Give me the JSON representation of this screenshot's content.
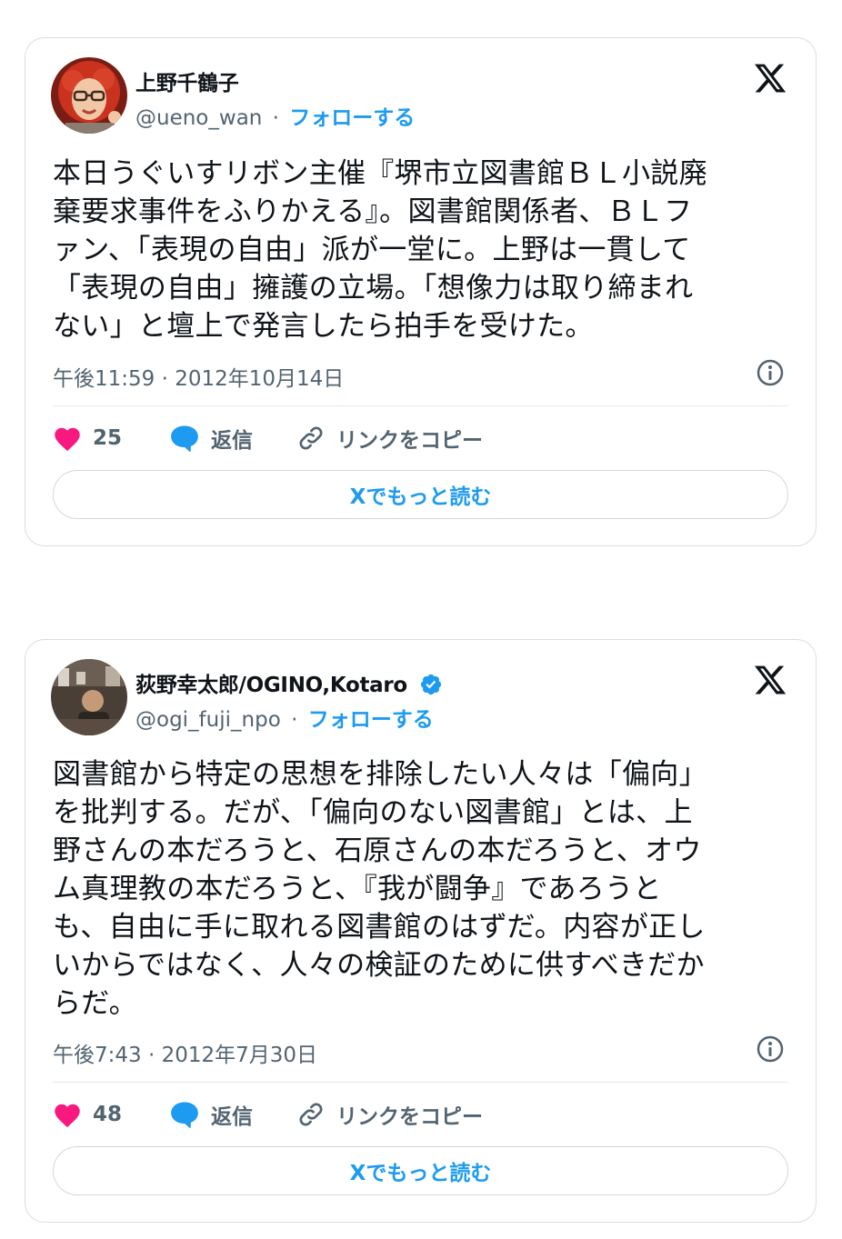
{
  "tweets": [
    {
      "author_name": "上野千鶴子",
      "handle": "@ueno_wan",
      "separator": "·",
      "follow_label": "フォローする",
      "verified": false,
      "body": "本日うぐいすリボン主催『堺市立図書館ＢＬ小説廃\n棄要求事件をふりかえる』。図書館関係者、ＢＬフ\nァン、「表現の自由」派が一堂に。上野は一貫して\n「表現の自由」擁護の立場。「想像力は取り締まれ\nない」と壇上で発言したら拍手を受けた。",
      "timestamp": "午後11:59 · 2012年10月14日",
      "likes": "25",
      "reply_label": "返信",
      "copy_link_label": "リンクをコピー",
      "read_more_label": "Xでもっと読む"
    },
    {
      "author_name": "荻野幸太郎/OGINO,Kotaro",
      "handle": "@ogi_fuji_npo",
      "separator": "·",
      "follow_label": "フォローする",
      "verified": true,
      "body": "図書館から特定の思想を排除したい人々は「偏向」\nを批判する。だが、「偏向のない図書館」とは、上\n野さんの本だろうと、石原さんの本だろうと、オウ\nム真理教の本だろうと、『我が闘争』であろうと\nも、自由に手に取れる図書館のはずだ。内容が正し\nいからではなく、人々の検証のために供すべきだか\nらだ。",
      "timestamp": "午後7:43 · 2012年7月30日",
      "likes": "48",
      "reply_label": "返信",
      "copy_link_label": "リンクをコピー",
      "read_more_label": "Xでもっと読む"
    }
  ],
  "colors": {
    "accent": "#1d9bf0",
    "like": "#f91880",
    "secondary_text": "#536471",
    "text": "#0f1419",
    "border": "#cfd9de"
  },
  "icons": [
    "x-logo-icon",
    "verified-badge-icon",
    "info-icon",
    "heart-icon",
    "reply-bubble-icon",
    "link-icon"
  ]
}
